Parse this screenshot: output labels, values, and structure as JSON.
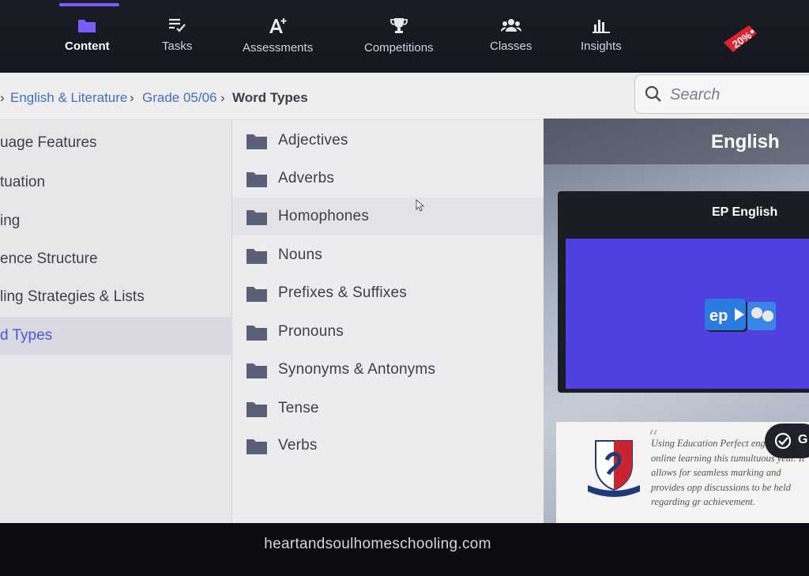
{
  "nav": {
    "items": [
      {
        "label": "Content",
        "icon": "folder-icon",
        "active": true
      },
      {
        "label": "Tasks",
        "icon": "tasks-icon",
        "active": false
      },
      {
        "label": "Assessments",
        "icon": "a-plus-icon",
        "active": false
      },
      {
        "label": "Competitions",
        "icon": "trophy-icon",
        "active": false
      },
      {
        "label": "Classes",
        "icon": "people-icon",
        "active": false
      },
      {
        "label": "Insights",
        "icon": "bar-chart-icon",
        "active": false
      }
    ],
    "badge": "20%",
    "accent": "#7b5cff"
  },
  "breadcrumb": {
    "items": [
      {
        "label": "English & Literature"
      },
      {
        "label": "Grade 05/06"
      }
    ],
    "current": "Word Types"
  },
  "search": {
    "placeholder": "Search"
  },
  "left_list": {
    "items": [
      {
        "label": "uage Features",
        "selected": false
      },
      {
        "label": "tuation",
        "selected": false
      },
      {
        "label": "ing",
        "selected": false
      },
      {
        "label": "ence Structure",
        "selected": false
      },
      {
        "label": "ling Strategies & Lists",
        "selected": false
      },
      {
        "label": "d Types",
        "selected": true
      }
    ]
  },
  "folders": {
    "items": [
      {
        "label": "Adjectives"
      },
      {
        "label": "Adverbs"
      },
      {
        "label": "Homophones"
      },
      {
        "label": "Nouns"
      },
      {
        "label": "Prefixes & Suffixes"
      },
      {
        "label": "Pronouns"
      },
      {
        "label": "Synonyms & Antonyms"
      },
      {
        "label": "Tense"
      },
      {
        "label": "Verbs"
      }
    ]
  },
  "right_panel": {
    "title": "English",
    "card_title": "EP English",
    "quote": "Using Education Perfect engagement in online learning this tumultuous year. It allows for seamless marking and provides opp discussions to be held regarding gr achievement.",
    "go_label": "G"
  },
  "watermark": "heartandsoulhomeschooling.com"
}
